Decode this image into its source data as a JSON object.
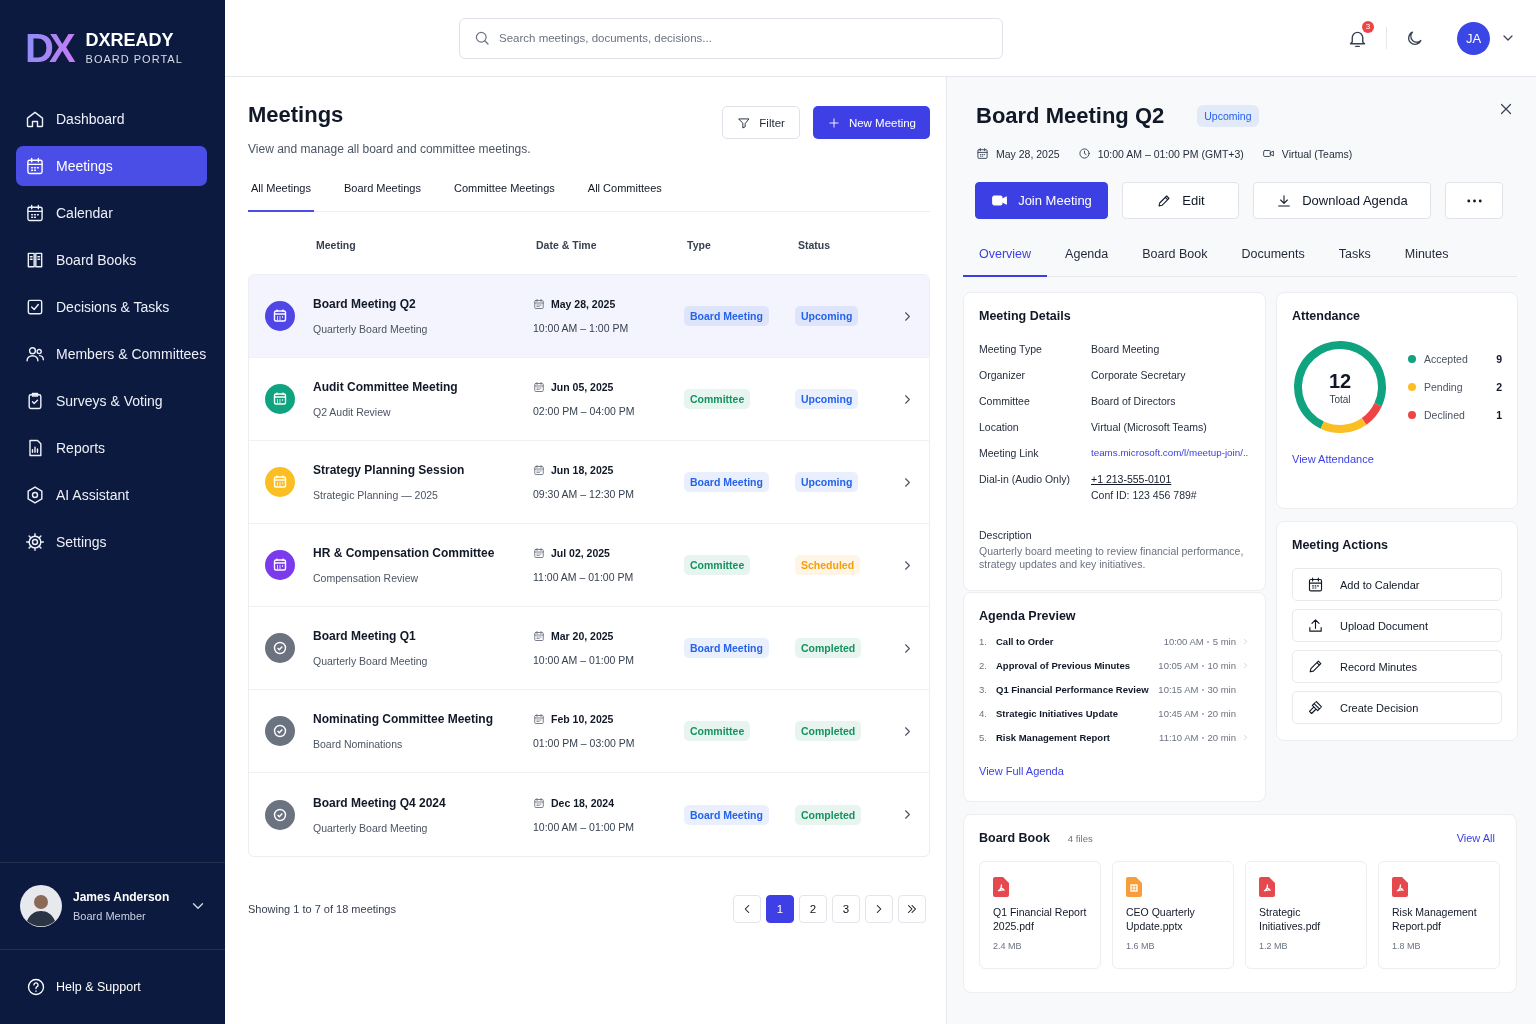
{
  "sidebar": {
    "logo_mark": "DX",
    "brand": "DXREADY",
    "tagline": "BOARD PORTAL",
    "items": [
      {
        "label": "Dashboard",
        "selected": false
      },
      {
        "label": "Meetings",
        "selected": true
      },
      {
        "label": "Calendar",
        "selected": false
      },
      {
        "label": "Board Books",
        "selected": false
      },
      {
        "label": "Decisions & Tasks",
        "selected": false
      },
      {
        "label": "Members & Committees",
        "selected": false
      },
      {
        "label": "Surveys & Voting",
        "selected": false
      },
      {
        "label": "Reports",
        "selected": false
      },
      {
        "label": "AI Assistant",
        "selected": false
      },
      {
        "label": "Settings",
        "selected": false
      }
    ],
    "user": {
      "name": "James Anderson",
      "role": "Board Member"
    },
    "help": "Help & Support"
  },
  "topbar": {
    "search": {
      "placeholder": "Search meetings, documents, decisions..."
    },
    "notifications": "3",
    "avatar": "JA"
  },
  "meetings": {
    "title": "Meetings",
    "subtitle": "View and manage all board and committee meetings.",
    "buttons": [
      {
        "label": "Filter",
        "kind": "outline"
      },
      {
        "label": "New Meeting",
        "kind": "primary"
      }
    ],
    "tabs": [
      {
        "label": "All Meetings",
        "selected": true
      },
      {
        "label": "Board Meetings",
        "selected": false
      },
      {
        "label": "Committee Meetings",
        "selected": false
      },
      {
        "label": "All Committees",
        "selected": false
      }
    ],
    "columns": [
      "Meeting",
      "Date & Time",
      "Type",
      "Status"
    ],
    "rows": [
      {
        "title": "Board Meeting Q2",
        "subtitle": "Quarterly Board Meeting",
        "date": "May 28, 2025",
        "time": "10:00 AM – 1:00 PM",
        "kind": "upcoming",
        "color": "#4f46e5",
        "type": {
          "label": "Board Meeting",
          "color": "#2563eb"
        },
        "status": {
          "label": "Upcoming",
          "color": "#2563eb"
        },
        "selected": true
      },
      {
        "title": "Audit Committee Meeting",
        "subtitle": "Q2 Audit Review",
        "date": "Jun 05, 2025",
        "time": "02:00 PM – 04:00 PM",
        "kind": "upcoming",
        "color": "#10a37f",
        "type": {
          "label": "Committee",
          "color": "#15935f"
        },
        "status": {
          "label": "Upcoming",
          "color": "#2563eb"
        },
        "selected": false
      },
      {
        "title": "Strategy Planning Session",
        "subtitle": "Strategic Planning — 2025",
        "date": "Jun 18, 2025",
        "time": "09:30 AM – 12:30 PM",
        "kind": "upcoming",
        "color": "#fbbf24",
        "type": {
          "label": "Board Meeting",
          "color": "#2563eb"
        },
        "status": {
          "label": "Upcoming",
          "color": "#2563eb"
        },
        "selected": false
      },
      {
        "title": "HR & Compensation Committee",
        "subtitle": "Compensation Review",
        "date": "Jul 02, 2025",
        "time": "11:00 AM – 01:00 PM",
        "kind": "upcoming",
        "color": "#7c3aed",
        "type": {
          "label": "Committee",
          "color": "#15935f"
        },
        "status": {
          "label": "Scheduled",
          "color": "#f59e0b"
        },
        "selected": false
      },
      {
        "title": "Board Meeting Q1",
        "subtitle": "Quarterly Board Meeting",
        "date": "Mar 20, 2025",
        "time": "10:00 AM – 01:00 PM",
        "kind": "completed",
        "color": "#6b7280",
        "type": {
          "label": "Board Meeting",
          "color": "#2563eb"
        },
        "status": {
          "label": "Completed",
          "color": "#15935f"
        },
        "selected": false
      },
      {
        "title": "Nominating Committee Meeting",
        "subtitle": "Board Nominations",
        "date": "Feb 10, 2025",
        "time": "01:00 PM – 03:00 PM",
        "kind": "completed",
        "color": "#6b7280",
        "type": {
          "label": "Committee",
          "color": "#15935f"
        },
        "status": {
          "label": "Completed",
          "color": "#15935f"
        },
        "selected": false
      },
      {
        "title": "Board Meeting Q4 2024",
        "subtitle": "Quarterly Board Meeting",
        "date": "Dec 18, 2024",
        "time": "10:00 AM – 01:00 PM",
        "kind": "completed",
        "color": "#6b7280",
        "type": {
          "label": "Board Meeting",
          "color": "#2563eb"
        },
        "status": {
          "label": "Completed",
          "color": "#15935f"
        },
        "selected": false
      }
    ],
    "footer": "Showing 1 to 7 of 18 meetings",
    "pages": [
      {
        "label": "1",
        "selected": true
      },
      {
        "label": "2",
        "selected": false
      },
      {
        "label": "3",
        "selected": false
      }
    ]
  },
  "detail": {
    "title": "Board Meeting Q2",
    "status": {
      "label": "Upcoming",
      "color": "#2563eb"
    },
    "meta": [
      "May 28, 2025",
      "10:00 AM – 01:00 PM (GMT+3)",
      "Virtual (Teams)"
    ],
    "actions": [
      {
        "label": "Join Meeting",
        "kind": "primary"
      },
      {
        "label": "Edit",
        "kind": "outline"
      },
      {
        "label": "Download Agenda",
        "kind": "outline"
      },
      {
        "kind": "more"
      }
    ],
    "tabs": [
      {
        "label": "Overview",
        "selected": true
      },
      {
        "label": "Agenda",
        "selected": false
      },
      {
        "label": "Board Book",
        "selected": false
      },
      {
        "label": "Documents",
        "selected": false
      },
      {
        "label": "Tasks",
        "selected": false
      },
      {
        "label": "Minutes",
        "selected": false
      }
    ],
    "details": {
      "title": "Meeting Details",
      "rows": [
        {
          "label": "Meeting Type",
          "value": "Board Meeting",
          "kind": "text"
        },
        {
          "label": "Organizer",
          "value": "Corporate Secretary",
          "kind": "text"
        },
        {
          "label": "Committee",
          "value": "Board of Directors",
          "kind": "text"
        },
        {
          "label": "Location",
          "value": "Virtual (Microsoft Teams)",
          "kind": "text"
        },
        {
          "label": "Meeting Link",
          "value": "teams.microsoft.com/l/meetup-join/..",
          "kind": "link"
        },
        {
          "label": "Dial-in (Audio Only)",
          "value": "+1 213-555-0101",
          "extra": "Conf ID: 123 456 789#",
          "kind": "phone"
        }
      ],
      "description_label": "Description",
      "description": "Quarterly board meeting to review financial performance, strategy updates and key initiatives."
    },
    "attendance": {
      "title": "Attendance",
      "total": "12",
      "total_label": "Total",
      "chart_data": {
        "type": "donut",
        "categories": [
          "Accepted",
          "Pending",
          "Declined"
        ],
        "values": [
          75,
          16.7,
          8.3
        ]
      },
      "legend": [
        {
          "count": "9",
          "color": "#10a37f"
        },
        {
          "count": "2",
          "color": "#fbbf24"
        },
        {
          "count": "1",
          "color": "#ef4444"
        }
      ],
      "link": "View Attendance"
    },
    "meeting_actions": {
      "title": "Meeting Actions",
      "items": [
        "Add to Calendar",
        "Upload Document",
        "Record Minutes",
        "Create Decision"
      ]
    },
    "agenda": {
      "title": "Agenda Preview",
      "items": [
        {
          "number": "1.",
          "title": "Call to Order",
          "time": "10:00 AM",
          "duration": "5 min",
          "chevron": true
        },
        {
          "number": "2.",
          "title": "Approval of Previous Minutes",
          "time": "10:05 AM",
          "duration": "10 min",
          "chevron": true
        },
        {
          "number": "3.",
          "title": "Q1 Financial Performance Review",
          "time": "10:15 AM",
          "duration": "30 min",
          "chevron": false
        },
        {
          "number": "4.",
          "title": "Strategic Initiatives Update",
          "time": "10:45 AM",
          "duration": "20 min",
          "chevron": false
        },
        {
          "number": "5.",
          "title": "Risk Management Report",
          "time": "11:10 AM",
          "duration": "20 min",
          "chevron": true
        }
      ],
      "link": "View Full Agenda"
    },
    "board_book": {
      "title": "Board Book",
      "count": "4 files",
      "link": "View All",
      "files": [
        {
          "name": "Q1 Financial Report 2025.pdf",
          "size": "2.4 MB",
          "kind": "pdf"
        },
        {
          "name": "CEO Quarterly Update.pptx",
          "size": "1.6 MB",
          "kind": "pptx"
        },
        {
          "name": "Strategic Initiatives.pdf",
          "size": "1.2 MB",
          "kind": "pdf"
        },
        {
          "name": "Risk Management Report.pdf",
          "size": "1.8 MB",
          "kind": "pdf"
        }
      ]
    }
  }
}
